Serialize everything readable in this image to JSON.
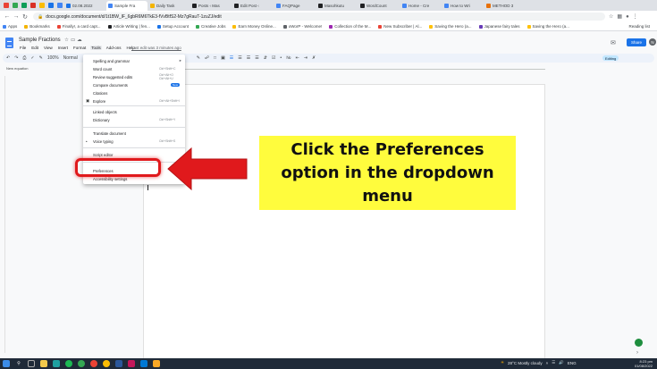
{
  "browser": {
    "tabs": [
      {
        "label": "02.08.2022",
        "color": "#1a73e8"
      },
      {
        "label": "Sample Fra",
        "color": "#4285f4",
        "active": true
      },
      {
        "label": "Daily Task",
        "color": "#f4b400"
      },
      {
        "label": "Posts ‹ Mas",
        "color": "#202124"
      },
      {
        "label": "Edit Post ‹",
        "color": "#202124"
      },
      {
        "label": "FAQPage",
        "color": "#4285f4"
      },
      {
        "label": "Masohkutu",
        "color": "#202124"
      },
      {
        "label": "WordCount",
        "color": "#202124"
      },
      {
        "label": "Home - Cre",
        "color": "#4285f4"
      },
      {
        "label": "How to Wri",
        "color": "#4285f4"
      },
      {
        "label": "METHOD 3",
        "color": "#e8710a"
      }
    ],
    "url": "docs.google.com/document/d/1t1BW_lF_6gbR6M6TkE3-fVvBtfS2-Mz7gRauT-1zuZJ/edit",
    "bookmarks": [
      "Apps",
      "Bookmarks",
      "Finally!, a card capt...",
      "Article Writing | fen...",
      "Setup Account",
      "Creative Jobs",
      "Earn Money Online...",
      "oWorP - Welcome!",
      "Collection of the M...",
      "New Subscriber | Al...",
      "Saving the Hero (a...",
      "Japanese fairy tales",
      "Saving the Hero (a..."
    ],
    "reading_list": "Reading list"
  },
  "docs": {
    "title": "Sample Fractions",
    "menu": [
      "File",
      "Edit",
      "View",
      "Insert",
      "Format",
      "Tools",
      "Add-ons",
      "Help"
    ],
    "active_menu": "Tools",
    "last_edit": "Last edit was 3 minutes ago",
    "share_label": "Share",
    "avatar_letter": "N",
    "zoom": "100%",
    "style": "Normal",
    "editing_label": "Editing",
    "outline_label": "New equation"
  },
  "tools_menu": {
    "items": [
      {
        "label": "Spelling and grammar",
        "shortcut": "",
        "icon": "",
        "arrow": true
      },
      {
        "label": "Word count",
        "shortcut": "Ctrl+Shift+C",
        "icon": ""
      },
      {
        "label": "Review suggested edits",
        "shortcut": "Ctrl+Alt+O Ctrl+Alt+U",
        "icon": ""
      },
      {
        "label": "Compare documents",
        "shortcut": "",
        "icon": "",
        "badge": "New"
      },
      {
        "label": "Citations",
        "shortcut": "",
        "icon": ""
      },
      {
        "label": "Explore",
        "shortcut": "Ctrl+Alt+Shift+I",
        "icon": "explore-icon"
      },
      {
        "label": "Linked objects",
        "shortcut": "",
        "icon": ""
      },
      {
        "label": "Dictionary",
        "shortcut": "Ctrl+Shift+Y",
        "icon": ""
      },
      {
        "label": "Translate document",
        "shortcut": "",
        "icon": ""
      },
      {
        "label": "Voice typing",
        "shortcut": "Ctrl+Shift+S",
        "icon": "microphone-icon"
      },
      {
        "label": "Script editor",
        "shortcut": "",
        "icon": ""
      },
      {
        "label": "Preferences",
        "shortcut": "",
        "icon": ""
      },
      {
        "label": "Accessibility settings",
        "shortcut": "",
        "icon": ""
      }
    ]
  },
  "callout": {
    "text": "Click the Preferences option in the dropdown menu"
  },
  "taskbar": {
    "weather": "28°C  Mostly cloudy",
    "language": "ENG",
    "time": "8:23 pm",
    "date": "01/08/2022"
  },
  "colors": {
    "highlight": "#e0191c",
    "callout_bg": "#fffc3d",
    "share": "#1a73e8"
  }
}
